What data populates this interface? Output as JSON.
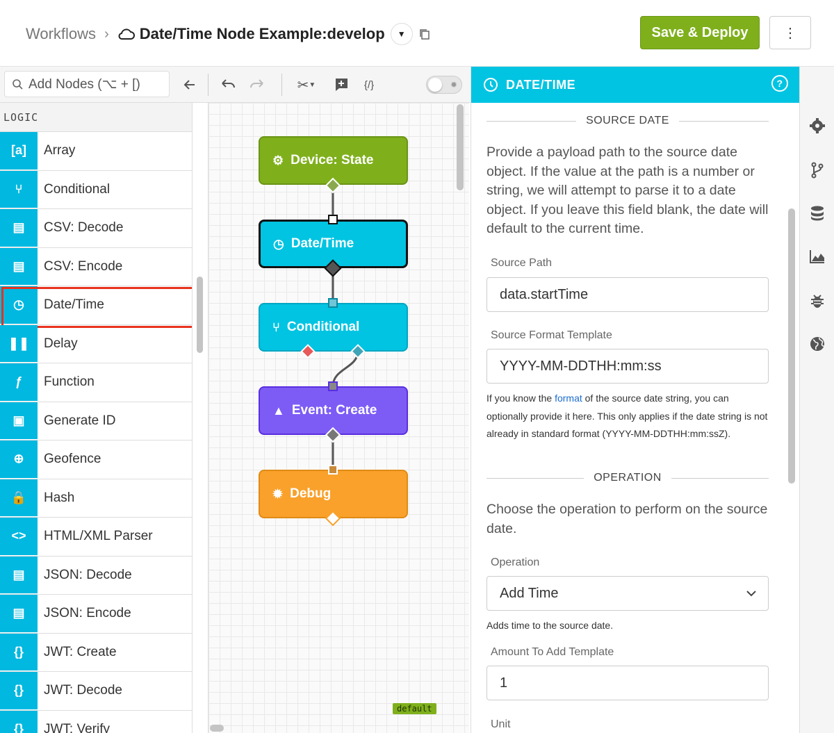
{
  "header": {
    "breadcrumb_root": "Workflows",
    "breadcrumb_sep": "›",
    "workflow_title": "Date/Time Node Example:develop",
    "save_deploy_label": "Save & Deploy",
    "more_label": "⋮"
  },
  "toolbar": {
    "search_placeholder": "Add Nodes (⌥ + [)"
  },
  "palette": {
    "category": "LOGIC",
    "items": [
      {
        "label": "Array",
        "icon": "[a]"
      },
      {
        "label": "Conditional",
        "icon": "⑂"
      },
      {
        "label": "CSV: Decode",
        "icon": "▤"
      },
      {
        "label": "CSV: Encode",
        "icon": "▤"
      },
      {
        "label": "Date/Time",
        "icon": "◷"
      },
      {
        "label": "Delay",
        "icon": "❚❚"
      },
      {
        "label": "Function",
        "icon": "ƒ"
      },
      {
        "label": "Generate ID",
        "icon": "▣"
      },
      {
        "label": "Geofence",
        "icon": "⊕"
      },
      {
        "label": "Hash",
        "icon": "🔒"
      },
      {
        "label": "HTML/XML Parser",
        "icon": "<>"
      },
      {
        "label": "JSON: Decode",
        "icon": "▤"
      },
      {
        "label": "JSON: Encode",
        "icon": "▤"
      },
      {
        "label": "JWT: Create",
        "icon": "{}"
      },
      {
        "label": "JWT: Decode",
        "icon": "{}"
      },
      {
        "label": "JWT: Verify",
        "icon": "{}"
      }
    ]
  },
  "canvas": {
    "nodes": [
      {
        "label": "Device: State",
        "color": "#7fb01c",
        "border": "#6a9416",
        "icon": "⚙"
      },
      {
        "label": "Date/Time",
        "color": "#00c4e2",
        "border": "#111111",
        "icon": "◷"
      },
      {
        "label": "Conditional",
        "color": "#00c4e2",
        "border": "#00a6c2",
        "icon": "⑂"
      },
      {
        "label": "Event: Create",
        "color": "#7d5cf5",
        "border": "#5a2ee0",
        "icon": "▲"
      },
      {
        "label": "Debug",
        "color": "#f9a12b",
        "border": "#e08b14",
        "icon": "✹"
      }
    ],
    "badge": "default"
  },
  "panel": {
    "title": "DATE/TIME",
    "source_section": "SOURCE DATE",
    "source_desc": "Provide a payload path to the source date object. If the value at the path is a number or string, we will attempt to parse it to a date object. If you leave this field blank, the date will default to the current time.",
    "source_path_label": "Source Path",
    "source_path_value": "data.startTime",
    "source_format_label": "Source Format Template",
    "source_format_value": "YYYY-MM-DDTHH:mm:ss",
    "hint_before": "If you know the ",
    "hint_link": "format",
    "hint_after": " of the source date string, you can optionally provide it here. This only applies if the date string is not already in standard format (YYYY-MM-DDTHH:mm:ssZ).",
    "operation_section": "OPERATION",
    "operation_desc": "Choose the operation to perform on the source date.",
    "operation_label": "Operation",
    "operation_value": "Add Time",
    "operation_hint": "Adds time to the source date.",
    "amount_label": "Amount To Add Template",
    "amount_value": "1",
    "unit_label": "Unit"
  },
  "colors": {
    "accent": "#00c4e2",
    "deploy": "#7fb01c",
    "highlight": "#e8321e"
  }
}
